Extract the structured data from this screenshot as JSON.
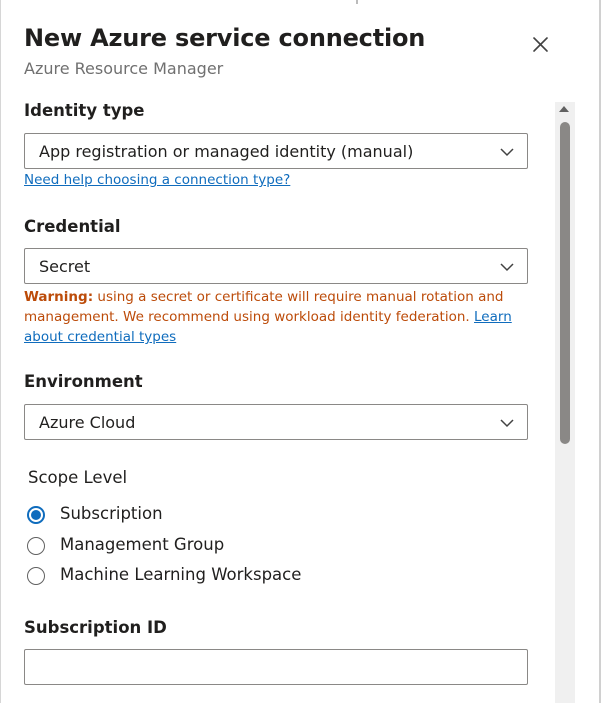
{
  "header": {
    "title": "New Azure service connection",
    "subtitle": "Azure Resource Manager",
    "close_icon": "close-icon"
  },
  "identity": {
    "label": "Identity type",
    "value": "App registration or managed identity (manual)",
    "help_link": "Need help choosing a connection type?"
  },
  "credential": {
    "label": "Credential",
    "value": "Secret",
    "warning_prefix": "Warning:",
    "warning_text": " using a secret or certificate will require manual rotation and management. We recommend using workload identity federation. ",
    "warning_link": "Learn about credential types"
  },
  "environment": {
    "label": "Environment",
    "value": "Azure Cloud"
  },
  "scope": {
    "label": "Scope Level",
    "options": [
      "Subscription",
      "Management Group",
      "Machine Learning Workspace"
    ],
    "selected": "Subscription"
  },
  "subscription": {
    "label": "Subscription ID",
    "value": ""
  },
  "colors": {
    "accent": "#0f6cbd",
    "warning": "#bc4b09",
    "text": "#201f1e",
    "subtle": "#707070"
  }
}
